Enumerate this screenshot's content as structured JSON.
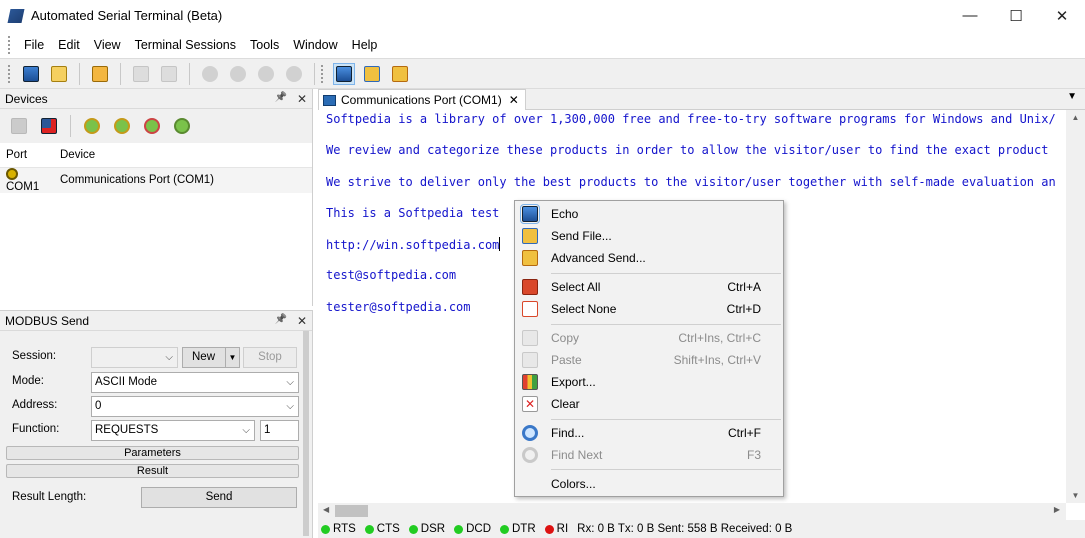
{
  "window": {
    "title": "Automated Serial Terminal (Beta)",
    "controls": [
      "—",
      "☐",
      "✕"
    ]
  },
  "menubar": [
    "File",
    "Edit",
    "View",
    "Terminal Sessions",
    "Tools",
    "Window",
    "Help"
  ],
  "devices": {
    "title": "Devices",
    "pin": "📌",
    "close": "✕",
    "columns": [
      "Port",
      "Device"
    ],
    "rows": [
      {
        "port": "COM1",
        "device": "Communications Port (COM1)"
      }
    ]
  },
  "modbus": {
    "title": "MODBUS Send",
    "pin": "📌",
    "close": "✕",
    "session_label": "Session:",
    "session_value": "",
    "new_button": "New",
    "stop_button": "Stop",
    "mode_label": "Mode:",
    "mode_value": "ASCII Mode",
    "address_label": "Address:",
    "address_value": "0",
    "function_label": "Function:",
    "function_value": "REQUESTS",
    "function_count": "1",
    "parameters_label": "Parameters",
    "result_label": "Result",
    "result_length_label": "Result Length:",
    "send_button": "Send"
  },
  "document": {
    "tab_label": "Communications Port (COM1)",
    "tab_close": "✕",
    "lines": [
      "Softpedia is a library of over 1,300,000 free and free-to-try software programs for Windows and Unix/",
      "We review and categorize these products in order to allow the visitor/user to find the exact product",
      "We strive to deliver only the best products to the visitor/user together with self-made evaluation an",
      "This is a Softpedia test",
      "http://win.softpedia.com",
      "test@softpedia.com",
      "tester@softpedia.com"
    ]
  },
  "status": {
    "leds": [
      {
        "label": "RTS",
        "color": "#22cc22"
      },
      {
        "label": "CTS",
        "color": "#22cc22"
      },
      {
        "label": "DSR",
        "color": "#22cc22"
      },
      {
        "label": "DCD",
        "color": "#22cc22"
      },
      {
        "label": "DTR",
        "color": "#22cc22"
      },
      {
        "label": "RI",
        "color": "#dd1111"
      }
    ],
    "counters": "Rx: 0 B Tx: 0 B Sent: 558 B Received: 0 B"
  },
  "context_menu": {
    "echo": {
      "label": "Echo",
      "icon": "echo-icon"
    },
    "send_file": {
      "label": "Send File...",
      "icon": "send-file-icon"
    },
    "advanced_send": {
      "label": "Advanced Send...",
      "icon": "advanced-send-icon"
    },
    "select_all": {
      "label": "Select All",
      "shortcut": "Ctrl+A",
      "icon": "select-all-icon"
    },
    "select_none": {
      "label": "Select None",
      "shortcut": "Ctrl+D",
      "icon": "select-none-icon"
    },
    "copy": {
      "label": "Copy",
      "shortcut": "Ctrl+Ins, Ctrl+C",
      "icon": "copy-icon"
    },
    "paste": {
      "label": "Paste",
      "shortcut": "Shift+Ins, Ctrl+V",
      "icon": "paste-icon"
    },
    "export": {
      "label": "Export...",
      "icon": "export-icon"
    },
    "clear": {
      "label": "Clear",
      "icon": "clear-icon"
    },
    "find": {
      "label": "Find...",
      "shortcut": "Ctrl+F",
      "icon": "find-icon"
    },
    "find_next": {
      "label": "Find Next",
      "shortcut": "F3",
      "icon": "find-next-icon"
    },
    "colors": {
      "label": "Colors..."
    }
  },
  "colors": {
    "terminal_text": "#1414cc",
    "panel_bg": "#f0f0f0"
  }
}
